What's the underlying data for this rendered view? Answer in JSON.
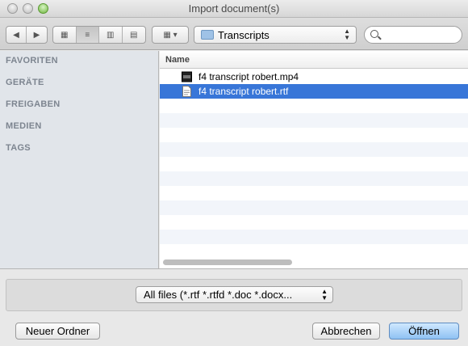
{
  "window": {
    "title": "Import document(s)"
  },
  "toolbar": {
    "path_popup": {
      "label": "Transcripts",
      "icon": "folder-icon"
    },
    "search": {
      "placeholder": ""
    },
    "nav_back": "◀",
    "nav_forward": "▶",
    "view_icon_glyph": "▦",
    "view_list_glyph": "≡",
    "view_columns_glyph": "▥",
    "view_coverflow_glyph": "▤",
    "arrange_glyph": "▦ ▾"
  },
  "sidebar": {
    "sections": [
      "FAVORITEN",
      "GERÄTE",
      "FREIGABEN",
      "MEDIEN",
      "TAGS"
    ]
  },
  "file_list": {
    "header": "Name",
    "items": [
      {
        "name": "f4 transcript robert.mp4",
        "icon": "video-file-icon",
        "selected": false
      },
      {
        "name": "f4 transcript robert.rtf",
        "icon": "document-file-icon",
        "selected": true
      }
    ]
  },
  "filter": {
    "label": "All files (*.rtf *.rtfd *.doc *.docx..."
  },
  "buttons": {
    "new_folder": "Neuer Ordner",
    "cancel": "Abbrechen",
    "open": "Öffnen"
  },
  "colors": {
    "selection": "#3876d8",
    "default_button": "#8fc2f3"
  }
}
